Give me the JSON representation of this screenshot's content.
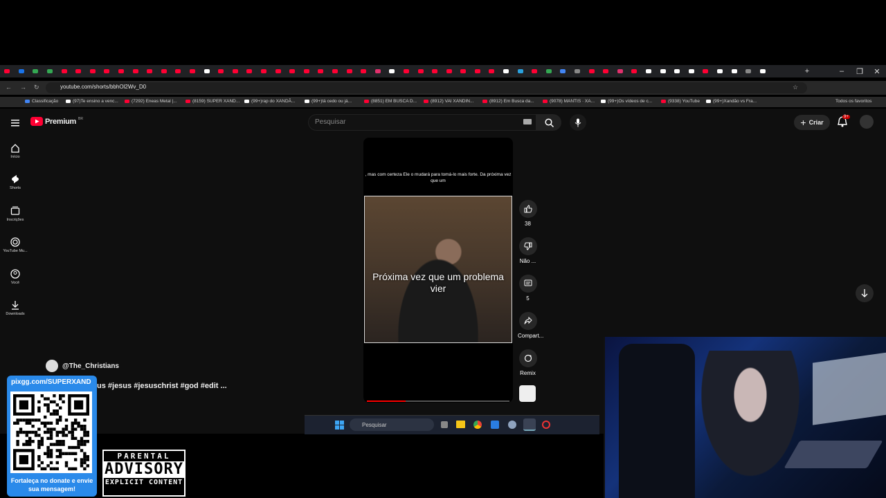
{
  "browser": {
    "url": "youtube.com/shorts/bbhOl2Wv_D0",
    "tabs_colors": [
      "#ff0033",
      "#1a73e8",
      "#34a853"
    ],
    "bookmarks": [
      {
        "label": "Classificação",
        "color": "#4285f4"
      },
      {
        "label": "(97)Te ensino a venc...",
        "color": "#ffffff"
      },
      {
        "label": "(7292) Eneas Metal |...",
        "color": "#ff0033"
      },
      {
        "label": "(8159) SUPER XAND...",
        "color": "#ff0033"
      },
      {
        "label": "(99+)rap do XANDÃ...",
        "color": "#ffffff"
      },
      {
        "label": "(99+)tá cedo ou já...",
        "color": "#ffffff"
      },
      {
        "label": "(8851) EM BUSCA D...",
        "color": "#ff0033"
      },
      {
        "label": "(8912) VAI XANDIN...",
        "color": "#ff0033"
      },
      {
        "label": "(8912) Em Busca da...",
        "color": "#ff0033"
      },
      {
        "label": "(9078) MANTIS · XA...",
        "color": "#ff0033"
      },
      {
        "label": "(99+)Os vídeos de c...",
        "color": "#ffffff"
      },
      {
        "label": "(9338) YouTube",
        "color": "#ff0033"
      },
      {
        "label": "(99+)Xandão vs Fra...",
        "color": "#ffffff"
      }
    ],
    "all_bookmarks": "Todos os favoritos"
  },
  "youtube": {
    "logo": "Premium",
    "region": "BR",
    "search_placeholder": "Pesquisar",
    "create_label": "Criar",
    "notif_badge": "9+",
    "sidebar": [
      {
        "label": "Início",
        "icon": "home-icon"
      },
      {
        "label": "Shorts",
        "icon": "shorts-icon"
      },
      {
        "label": "Inscrições",
        "icon": "subscriptions-icon"
      },
      {
        "label": "YouTube Mu...",
        "icon": "music-icon"
      },
      {
        "label": "Você",
        "icon": "you-icon"
      },
      {
        "label": "Downloads",
        "icon": "download-icon"
      }
    ],
    "short": {
      "subtitle_top": ", mas com certeza Ele o mudará para tomá-lo mais forte.  Da próxima vez que um",
      "caption": "Próxima vez que um problema vier",
      "progress": 0.27,
      "channel": "@The_Christians",
      "tags": "us #jesus #jesuschrist #god #edit ...",
      "actions": [
        {
          "icon": "like-icon",
          "label": "38"
        },
        {
          "icon": "dislike-icon",
          "label": "Não ..."
        },
        {
          "icon": "comment-icon",
          "label": "5"
        },
        {
          "icon": "share-icon",
          "label": "Compart..."
        },
        {
          "icon": "remix-icon",
          "label": "Remix"
        }
      ]
    }
  },
  "taskbar": {
    "search": "Pesquisar"
  },
  "overlay": {
    "donate_url": "pixgg.com/SUPERXAND",
    "donate_msg": "Fortaleça no donate e envie sua mensagem!",
    "pa_line1": "PARENTAL",
    "pa_line2": "ADVISORY",
    "pa_line3": "EXPLICIT CONTENT"
  }
}
